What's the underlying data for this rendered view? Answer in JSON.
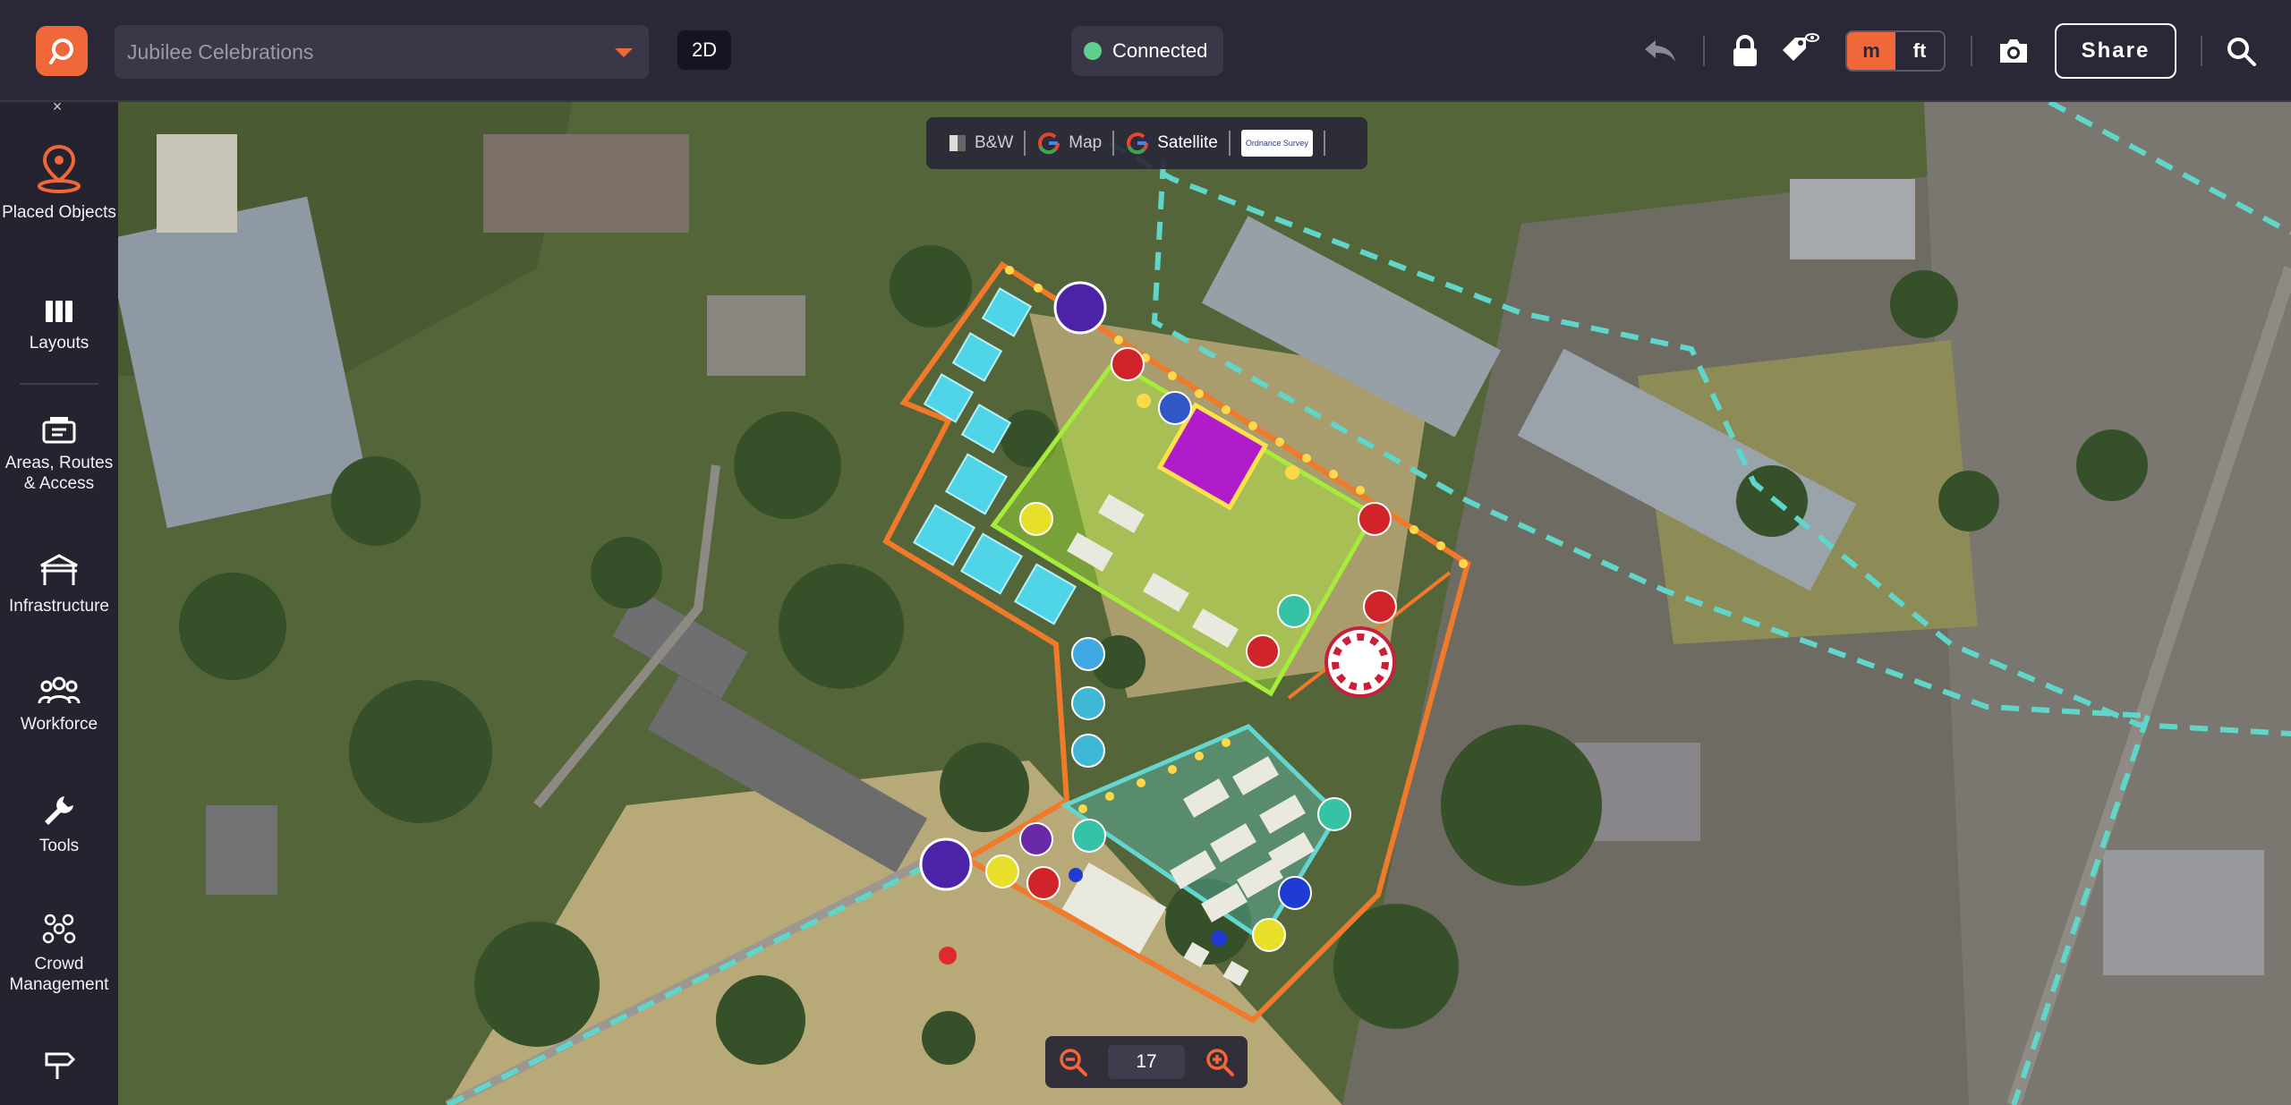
{
  "header": {
    "project_name": "Jubilee Celebrations",
    "view_mode": "2D",
    "connection_status": "Connected",
    "units": {
      "metric": "m",
      "imperial": "ft",
      "active": "m"
    },
    "share_label": "Share",
    "icons": [
      "logo-icon",
      "chevron-down-icon",
      "undo-icon",
      "lock-icon",
      "tag-visibility-icon",
      "camera-icon",
      "search-icon"
    ],
    "colors": {
      "accent": "#f0683a",
      "connected": "#5fd08d",
      "bar": "#2a2837"
    }
  },
  "sidebar": {
    "items": [
      {
        "label": "Placed Objects",
        "icon": "map-pin-icon",
        "active": true
      },
      {
        "label": "Layouts",
        "icon": "columns-icon"
      },
      {
        "label": "Areas, Routes & Access",
        "icon": "ticket-icon"
      },
      {
        "label": "Infrastructure",
        "icon": "gazebo-icon"
      },
      {
        "label": "Workforce",
        "icon": "people-icon"
      },
      {
        "label": "Tools",
        "icon": "wrench-icon"
      },
      {
        "label": "Crowd Management",
        "icon": "crowd-icon"
      },
      {
        "label": "",
        "icon": "signpost-icon"
      }
    ]
  },
  "map": {
    "layers": [
      {
        "label": "B&W",
        "icon": "bw-icon"
      },
      {
        "label": "Map",
        "icon": "google-g-icon"
      },
      {
        "label": "Satellite",
        "icon": "google-g-icon",
        "active": true
      },
      {
        "label": "Ordnance Survey",
        "icon": "os-logo"
      }
    ],
    "zoom": "17",
    "colors": {
      "site_boundary": "#f07a2a",
      "green_zone": "#a6ec3a",
      "teal_zone": "#62d6cf",
      "route": "#5fd6c9",
      "stage": "#b01cc9"
    }
  }
}
